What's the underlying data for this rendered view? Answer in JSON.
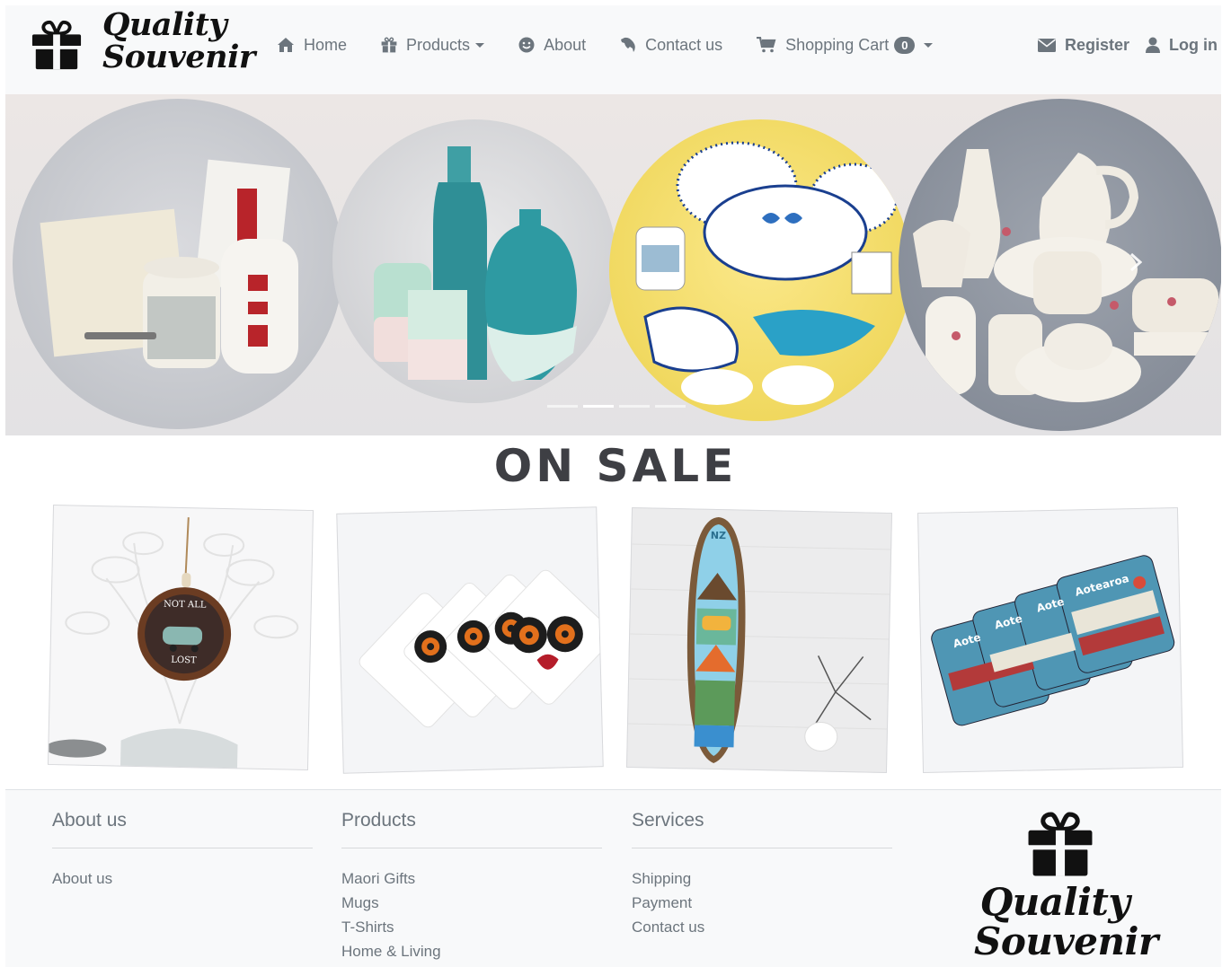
{
  "brand": {
    "line1": "Quality",
    "line2": "Souvenir"
  },
  "nav": {
    "home": "Home",
    "products": "Products",
    "about": "About",
    "contact": "Contact us",
    "cart": "Shopping Cart",
    "cart_count": "0",
    "register": "Register",
    "login": "Log in"
  },
  "carousel": {
    "slide_count": 4,
    "active_index": 1
  },
  "sale": {
    "title": "ON SALE"
  },
  "footer": {
    "about": {
      "heading": "About us",
      "items": [
        "About us"
      ]
    },
    "products": {
      "heading": "Products",
      "items": [
        "Maori Gifts",
        "Mugs",
        "T-Shirts",
        "Home & Living"
      ]
    },
    "services": {
      "heading": "Services",
      "items": [
        "Shipping",
        "Payment",
        "Contact us"
      ]
    }
  },
  "colors": {
    "nav_text": "#6c757d",
    "navbar_bg": "#f8f9fa",
    "brand_dark": "#111111",
    "sale_title": "#3e3f44"
  },
  "icons": [
    "gift-icon",
    "home-icon",
    "smile-icon",
    "phone-icon",
    "cart-icon",
    "envelope-icon",
    "user-icon",
    "chevron-right-icon"
  ]
}
